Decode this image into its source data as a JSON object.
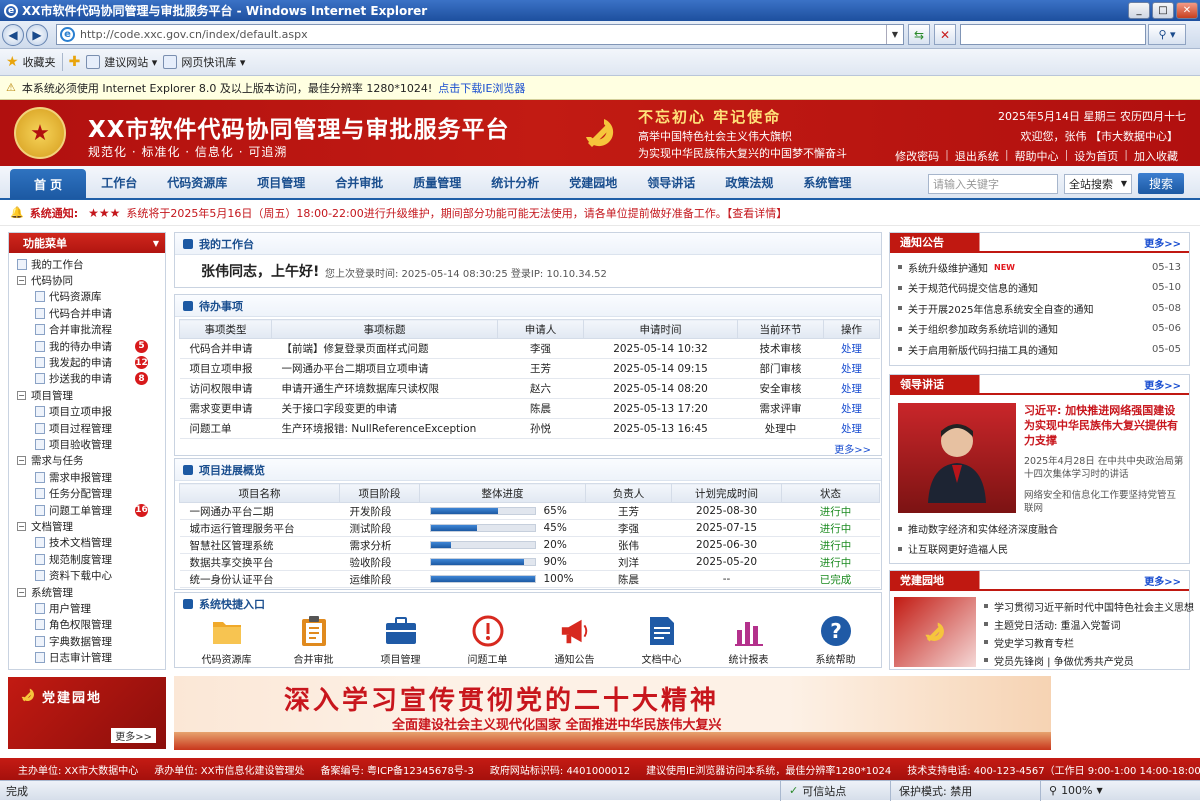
{
  "window": {
    "title": "XX市软件代码协同管理与审批服务平台 - Windows Internet Explorer",
    "min": "_",
    "max": "□",
    "close": "✕"
  },
  "browser": {
    "url": "http://code.xxc.gov.cn/index/default.aspx",
    "favorites_label": "收藏夹",
    "fav_items": [
      "建议网站 ▾",
      "网页快讯库 ▾"
    ],
    "info_text": "本系统必须使用 Internet Explorer 8.0 及以上版本访问，最佳分辨率 1280*1024!",
    "info_link": "点击下载IE浏览器"
  },
  "header": {
    "title": "XX市软件代码协同管理与审批服务平台",
    "subtitle": "规范化 · 标准化 · 信息化 · 可追溯",
    "slogan_main": "不忘初心  牢记使命",
    "slogan_line1": "高举中国特色社会主义伟大旗帜",
    "slogan_line2": "为实现中华民族伟大复兴的中国梦不懈奋斗",
    "date": "2025年5月14日  星期三  农历四月十七",
    "welcome": "欢迎您，张伟   【市大数据中心】",
    "links": [
      "修改密码",
      "退出系统",
      "帮助中心",
      "设为首页",
      "加入收藏"
    ]
  },
  "nav": {
    "items": [
      "首 页",
      "工作台",
      "代码资源库",
      "项目管理",
      "合并审批",
      "质量管理",
      "统计分析",
      "党建园地",
      "领导讲话",
      "政策法规",
      "系统管理"
    ],
    "search_placeholder": "请输入关键字",
    "search_scope": "全站搜索",
    "search_button": "搜索"
  },
  "notice_bar": {
    "label": "系统通知:",
    "stars": "★★★",
    "text": "系统将于2025年5月16日（周五）18:00-22:00进行升级维护，期间部分功能可能无法使用，请各单位提前做好准备工作。【查看详情】"
  },
  "left_menu": {
    "title": "功能菜单",
    "rows": [
      {
        "label": "我的工作台",
        "level": 0,
        "fold": ""
      },
      {
        "label": "代码协同",
        "level": 0,
        "fold": "−"
      },
      {
        "label": "代码资源库",
        "level": 1
      },
      {
        "label": "代码合并申请",
        "level": 1
      },
      {
        "label": "合并审批流程",
        "level": 1
      },
      {
        "label": "我的待办申请",
        "level": 1,
        "badge": "5"
      },
      {
        "label": "我发起的申请",
        "level": 1,
        "badge": "12"
      },
      {
        "label": "抄送我的申请",
        "level": 1,
        "badge": "8"
      },
      {
        "label": "项目管理",
        "level": 0,
        "fold": "−"
      },
      {
        "label": "项目立项申报",
        "level": 1
      },
      {
        "label": "项目过程管理",
        "level": 1
      },
      {
        "label": "项目验收管理",
        "level": 1
      },
      {
        "label": "需求与任务",
        "level": 0,
        "fold": "−"
      },
      {
        "label": "需求申报管理",
        "level": 1
      },
      {
        "label": "任务分配管理",
        "level": 1
      },
      {
        "label": "问题工单管理",
        "level": 1,
        "badge": "16"
      },
      {
        "label": "文档管理",
        "level": 0,
        "fold": "−"
      },
      {
        "label": "技术文档管理",
        "level": 1
      },
      {
        "label": "规范制度管理",
        "level": 1
      },
      {
        "label": "资料下载中心",
        "level": 1
      },
      {
        "label": "系统管理",
        "level": 0,
        "fold": "−"
      },
      {
        "label": "用户管理",
        "level": 1
      },
      {
        "label": "角色权限管理",
        "level": 1
      },
      {
        "label": "字典数据管理",
        "level": 1
      },
      {
        "label": "日志审计管理",
        "level": 1
      }
    ]
  },
  "left_ad": {
    "title": "党建园地",
    "more": "更多>>"
  },
  "workbench": {
    "title": "我的工作台",
    "greeting": "张伟同志，上午好!",
    "last_login": "您上次登录时间: 2025-05-14 08:30:25    登录IP: 10.10.34.52"
  },
  "todo": {
    "title": "待办事项",
    "columns": [
      "事项类型",
      "事项标题",
      "申请人",
      "申请时间",
      "当前环节",
      "操作"
    ],
    "rows": [
      [
        "代码合并申请",
        "【前端】修复登录页面样式问题",
        "李强",
        "2025-05-14  10:32",
        "技术审核",
        "处理"
      ],
      [
        "项目立项申报",
        "一网通办平台二期项目立项申请",
        "王芳",
        "2025-05-14  09:15",
        "部门审核",
        "处理"
      ],
      [
        "访问权限申请",
        "申请开通生产环境数据库只读权限",
        "赵六",
        "2025-05-14  08:20",
        "安全审核",
        "处理"
      ],
      [
        "需求变更申请",
        "关于接口字段变更的申请",
        "陈晨",
        "2025-05-13  17:20",
        "需求评审",
        "处理"
      ],
      [
        "问题工单",
        "生产环境报错: NullReferenceException",
        "孙悦",
        "2025-05-13  16:45",
        "处理中",
        "处理"
      ]
    ],
    "more": "更多>>"
  },
  "projects": {
    "title": "项目进展概览",
    "columns": [
      "项目名称",
      "项目阶段",
      "整体进度",
      "负责人",
      "计划完成时间",
      "状态"
    ],
    "rows": [
      {
        "name": "一网通办平台二期",
        "stage": "开发阶段",
        "progress": 65,
        "progress_text": "65%",
        "owner": "王芳",
        "due": "2025-08-30",
        "status": "进行中"
      },
      {
        "name": "城市运行管理服务平台",
        "stage": "测试阶段",
        "progress": 45,
        "progress_text": "45%",
        "owner": "李强",
        "due": "2025-07-15",
        "status": "进行中"
      },
      {
        "name": "智慧社区管理系统",
        "stage": "需求分析",
        "progress": 20,
        "progress_text": "20%",
        "owner": "张伟",
        "due": "2025-06-30",
        "status": "进行中"
      },
      {
        "name": "数据共享交换平台",
        "stage": "验收阶段",
        "progress": 90,
        "progress_text": "90%",
        "owner": "刘洋",
        "due": "2025-05-20",
        "status": "进行中"
      },
      {
        "name": "统一身份认证平台",
        "stage": "运维阶段",
        "progress": 100,
        "progress_text": "100%",
        "owner": "陈晨",
        "due": "--",
        "status": "已完成"
      }
    ]
  },
  "quick": {
    "title": "系统快捷入口",
    "items": [
      {
        "label": "代码资源库",
        "icon": "folder-icon",
        "color": "#f0a92a"
      },
      {
        "label": "合并审批",
        "icon": "clipboard-icon",
        "color": "#e08a1e"
      },
      {
        "label": "项目管理",
        "icon": "briefcase-icon",
        "color": "#1f5aa6"
      },
      {
        "label": "问题工单",
        "icon": "alert-icon",
        "color": "#d7291f"
      },
      {
        "label": "通知公告",
        "icon": "megaphone-icon",
        "color": "#d7291f"
      },
      {
        "label": "文档中心",
        "icon": "document-icon",
        "color": "#1f5aa6"
      },
      {
        "label": "统计报表",
        "icon": "bar-chart-icon",
        "color": "#b4318c"
      },
      {
        "label": "系统帮助",
        "icon": "help-icon",
        "color": "#1f5aa6"
      }
    ]
  },
  "big_banner": {
    "line1": "深入学习宣传贯彻党的二十大精神",
    "line2": "全面建设社会主义现代化国家  全面推进中华民族伟大复兴"
  },
  "notice_panel": {
    "title": "通知公告",
    "more": "更多>>",
    "items": [
      {
        "text": "系统升级维护通知",
        "new": "NEW",
        "date": "05-13"
      },
      {
        "text": "关于规范代码提交信息的通知",
        "date": "05-10"
      },
      {
        "text": "关于开展2025年信息系统安全自查的通知",
        "date": "05-08"
      },
      {
        "text": "关于组织参加政务系统培训的通知",
        "date": "05-06"
      },
      {
        "text": "关于启用新版代码扫描工具的通知",
        "date": "05-05"
      }
    ]
  },
  "speech_panel": {
    "title": "领导讲话",
    "more": "更多>>",
    "headline": "习近平: 加快推进网络强国建设为实现中华民族伟大复兴提供有力支撑",
    "sub1": "2025年4月28日 在中共中央政治局第十四次集体学习时的讲话",
    "sub2": "网络安全和信息化工作要坚持党管互联网",
    "items": [
      "推动数字经济和实体经济深度融合",
      "让互联网更好造福人民"
    ]
  },
  "party_panel": {
    "title": "党建园地",
    "more": "更多>>",
    "items": [
      "学习贯彻习近平新时代中国特色社会主义思想",
      "主题党日活动: 重温入党誓词",
      "党史学习教育专栏",
      "党员先锋岗  |  争做优秀共产党员"
    ]
  },
  "footer": {
    "items": [
      "主办单位: XX市大数据中心",
      "承办单位: XX市信息化建设管理处",
      "备案编号: 粤ICP备12345678号-3",
      "政府网站标识码: 4401000012",
      "建议使用IE浏览器访问本系统，最佳分辨率1280*1024",
      "技术支持电话: 400-123-4567（工作日 9:00-1:00 14:00-18:00）"
    ]
  },
  "statusbar": {
    "done": "完成",
    "zone": "可信站点",
    "protect": "保护模式: 禁用",
    "zoom": "100%"
  }
}
